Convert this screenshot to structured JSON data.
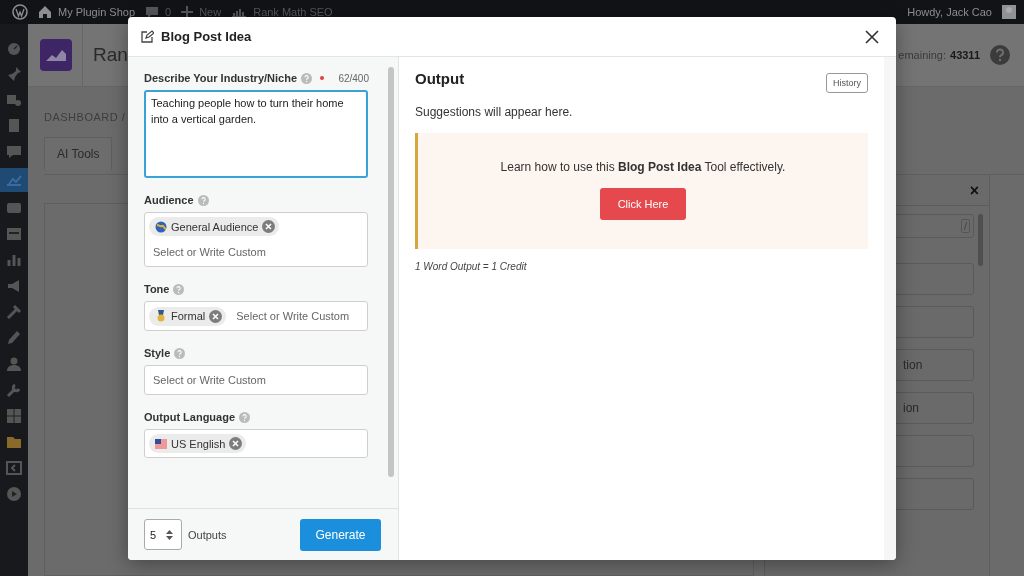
{
  "admin_bar": {
    "site": "My Plugin Shop",
    "comments": "0",
    "new": "New",
    "plugin": "Rank Math SEO",
    "greeting": "Howdy, Jack Cao"
  },
  "page": {
    "title": "Ran",
    "credits_label": "emaining:",
    "credits_value": "43311",
    "breadcrumb": "DASHBOARD /",
    "tabs": [
      "AI Tools"
    ],
    "side_panel": {
      "close": "×",
      "search_key": "/",
      "buttons": [
        {
          "label": "tion"
        },
        {
          "label": "ion"
        }
      ]
    }
  },
  "modal": {
    "title": "Blog Post Idea",
    "fields": [
      {
        "kind": "textarea",
        "label": "Describe Your Industry/Niche",
        "required": true,
        "counter": "62/400",
        "value": "Teaching people how to turn their home into a vertical garden."
      },
      {
        "kind": "tags",
        "label": "Audience",
        "tags": [
          "General Audience"
        ],
        "placeholder": "Select or Write Custom"
      },
      {
        "kind": "tags",
        "label": "Tone",
        "tags": [
          "Formal"
        ],
        "placeholder": "Select or Write Custom"
      },
      {
        "kind": "tags",
        "label": "Style",
        "placeholder": "Select or Write Custom"
      },
      {
        "kind": "tags",
        "label": "Output Language",
        "tags": [
          "US English"
        ]
      }
    ],
    "outputs": {
      "value": "5",
      "label": "Outputs"
    },
    "generate": "Generate",
    "output": {
      "title": "Output",
      "history": "History",
      "empty": "Suggestions will appear here.",
      "notice": "Learn how to use this **Blog Post Idea** Tool effectively.",
      "cta": "Click Here",
      "footnote": "1 Word Output = 1 Credit"
    }
  }
}
